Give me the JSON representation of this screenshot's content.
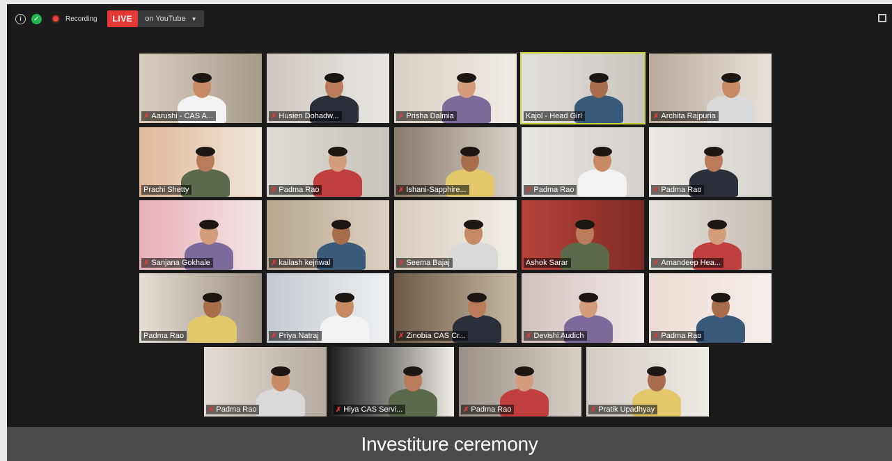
{
  "toolbar": {
    "recording_label": "Recording",
    "live_label": "LIVE",
    "stream_label": "on YouTube",
    "dropdown_glyph": "▼",
    "icons": [
      "info-icon",
      "shield-icon",
      "record-icon",
      "fullscreen-icon"
    ]
  },
  "participants": [
    {
      "name": "Aarushi - CAS A...",
      "muted": true,
      "active": false
    },
    {
      "name": "Husien Dohadw...",
      "muted": true,
      "active": false
    },
    {
      "name": "Prisha Dalmia",
      "muted": true,
      "active": false
    },
    {
      "name": "Kajol - Head Girl",
      "muted": false,
      "active": true
    },
    {
      "name": "Archita Rajpuria",
      "muted": true,
      "active": false
    },
    {
      "name": "Prachi Shetty",
      "muted": false,
      "active": false
    },
    {
      "name": "Padma Rao",
      "muted": true,
      "active": false
    },
    {
      "name": "Ishani-Sapphire...",
      "muted": true,
      "active": false
    },
    {
      "name": "Padma Rao",
      "muted": true,
      "active": false
    },
    {
      "name": "Padma Rao",
      "muted": true,
      "active": false
    },
    {
      "name": "Sanjana Gokhale",
      "muted": true,
      "active": false
    },
    {
      "name": "kailash kejriwal",
      "muted": true,
      "active": false
    },
    {
      "name": "Seema Bajaj",
      "muted": true,
      "active": false
    },
    {
      "name": "Ashok Sarar",
      "muted": false,
      "active": false
    },
    {
      "name": "Amandeep Hea...",
      "muted": true,
      "active": false
    },
    {
      "name": "Padma Rao",
      "muted": false,
      "active": false
    },
    {
      "name": "Priya Natraj",
      "muted": true,
      "active": false
    },
    {
      "name": "Zinobia CAS Cr...",
      "muted": true,
      "active": false
    },
    {
      "name": "Devishi Audich",
      "muted": true,
      "active": false
    },
    {
      "name": "Padma Rao",
      "muted": true,
      "active": false
    },
    {
      "name": "Padma Rao",
      "muted": true,
      "active": false
    },
    {
      "name": "Hiya CAS Servi...",
      "muted": true,
      "active": false
    },
    {
      "name": "Padma Rao",
      "muted": true,
      "active": false
    },
    {
      "name": "Pratik Upadhyay",
      "muted": true,
      "active": false
    }
  ],
  "caption": "Investiture ceremony",
  "colors": {
    "mic_muted": "#e53935",
    "live": "#e53935",
    "active_speaker": "#c8d43a",
    "shield": "#21b54a"
  }
}
